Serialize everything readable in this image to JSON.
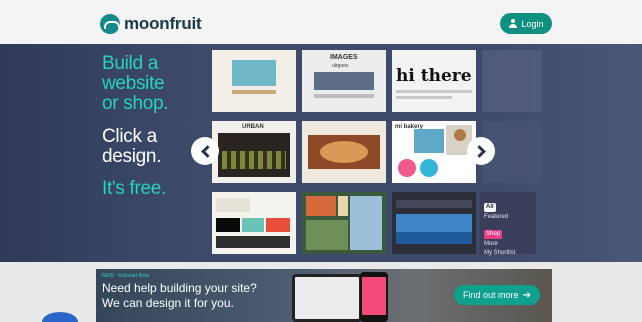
{
  "header": {
    "logo_text": "moonfruit",
    "login_label": "Login"
  },
  "hero": {
    "tagline_1": [
      "Build a",
      "website",
      "or shop."
    ],
    "tagline_2": [
      "Click a",
      "design."
    ],
    "tagline_3": "It's free.",
    "thumb_labels": {
      "images_title": "IMAGES",
      "images_sub": "ulrgoes",
      "hi_there": "hi there",
      "urban": "URBAN",
      "mi_bakery": "mi bakery"
    },
    "side_menu": {
      "badge": "All",
      "items": [
        "Featured",
        "Shop",
        "More",
        "My Shortlist"
      ]
    }
  },
  "promo": {
    "new_label": "NEW - Kickstart Beta",
    "line_1": "Need help building your site?",
    "line_2": "We can design it for you.",
    "button_label": "Find out more"
  },
  "icons": {
    "login": "user-icon",
    "prev": "chevron-left-icon",
    "next": "chevron-right-icon",
    "find_out_more": "arrow-right-icon"
  },
  "colors": {
    "brand_teal": "#109080",
    "hero_bg": "#3c4867",
    "tagline_teal": "#26d2c2",
    "header_bg": "#f4f4f4"
  }
}
